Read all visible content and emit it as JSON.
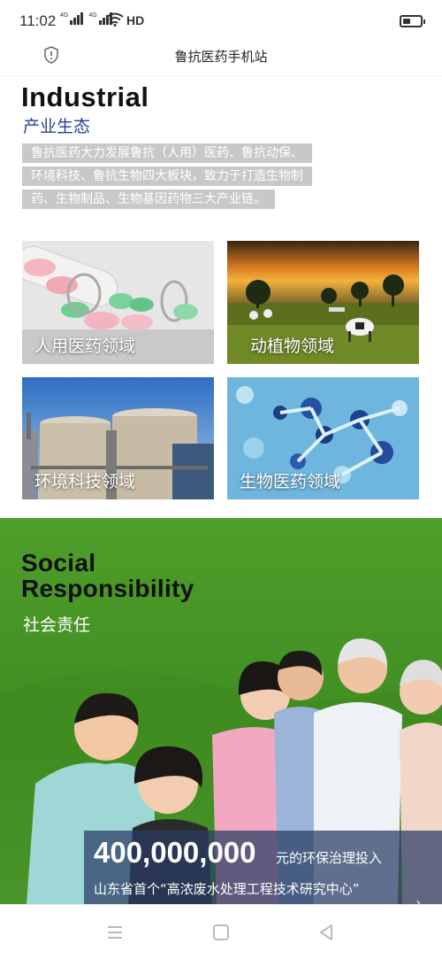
{
  "status_bar": {
    "time": "11:02",
    "network_labels": [
      "4G",
      "4G"
    ],
    "hd_label": "HD",
    "battery_level": 0.45
  },
  "browser": {
    "page_title": "鲁抗医药手机站"
  },
  "industrial": {
    "title_en": "Industrial",
    "title_cn": "产业生态",
    "description_lines": [
      "鲁抗医药大力发展鲁抗（人用）医药、鲁抗动保、",
      "环境科技、鲁抗生物四大板块，致力于打造生物制",
      "药、生物制品、生物基因药物三大产业链。"
    ],
    "tiles": [
      {
        "label": "人用医药领域"
      },
      {
        "label": "动植物领域"
      },
      {
        "label": "环境科技领域"
      },
      {
        "label": "生物医药领域"
      }
    ]
  },
  "social": {
    "title_en_line1": "Social",
    "title_en_line2": "Responsibility",
    "title_cn": "社会责任",
    "stat_number": "400,000,000",
    "stat_unit": "元的环保治理投入",
    "stat_text": "山东省首个“高浓废水处理工程技术研究中心”"
  },
  "colors": {
    "brand_blue": "#2a3f8f",
    "social_green": "#4f9e2a"
  },
  "icons": {
    "security": "shield-icon",
    "nav": [
      "menu-icon",
      "home-icon",
      "back-icon"
    ]
  }
}
